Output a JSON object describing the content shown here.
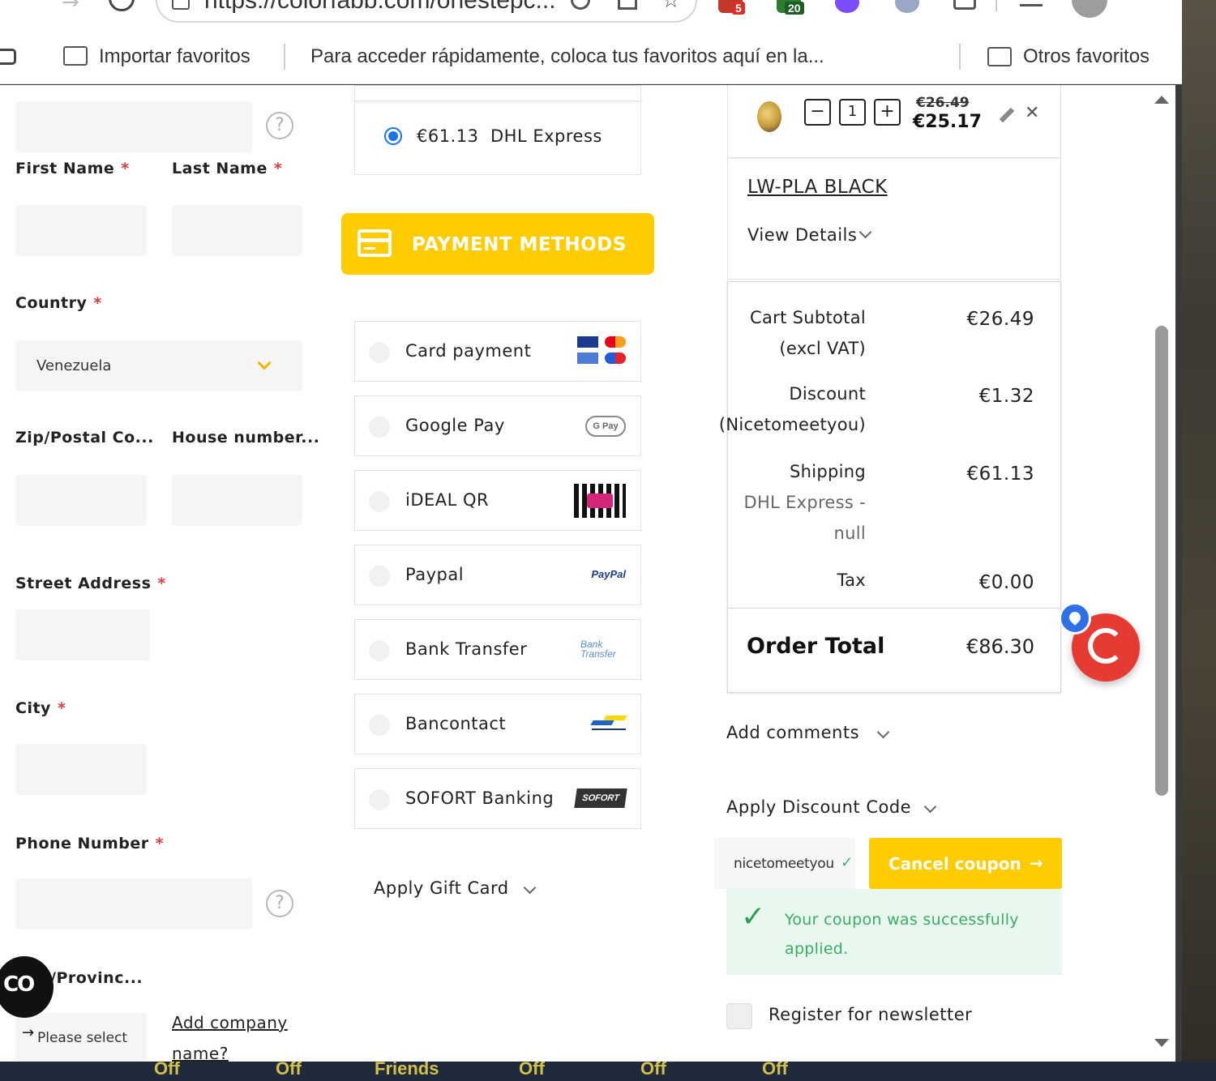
{
  "browser": {
    "url": "https://colorfabb.com/onestepc...",
    "badges": {
      "ext1": "5",
      "ext2": "20"
    }
  },
  "bookmarks": {
    "import": "Importar favoritos",
    "hint": "Para acceder rápidamente, coloca tus favoritos aquí en la...",
    "other": "Otros favoritos"
  },
  "form": {
    "first_name": "First Name",
    "last_name": "Last Name",
    "country": "Country",
    "country_value": "Venezuela",
    "zip": "Zip/Postal Co...",
    "house": "House number...",
    "street": "Street Address",
    "city": "City",
    "phone": "Phone Number",
    "province": "/Provinc...",
    "province_value": "Please select",
    "add_company_1": "Add company",
    "add_company_2": "name?",
    "required": "*",
    "help": "?"
  },
  "shipping": {
    "price": "€61.13",
    "carrier": "DHL Express"
  },
  "payment": {
    "title": "PAYMENT METHODS",
    "options": [
      {
        "label": "Card payment",
        "logo": "visa-mastercard-icon"
      },
      {
        "label": "Google Pay",
        "logo": "G Pay"
      },
      {
        "label": "iDEAL QR",
        "logo": "ideal-qr-icon"
      },
      {
        "label": "Paypal",
        "logo": "PayPal"
      },
      {
        "label": "Bank Transfer",
        "logo": "Bank Transfer"
      },
      {
        "label": "Bancontact",
        "logo": "bancontact-icon"
      },
      {
        "label": "SOFORT Banking",
        "logo": "SOFORT"
      }
    ],
    "gift_card": "Apply Gift Card"
  },
  "cart": {
    "qty": "1",
    "minus": "−",
    "plus": "+",
    "old_price": "€26.49",
    "new_price": "€25.17",
    "product": "LW-PLA BLACK",
    "view_details": "View Details"
  },
  "totals": {
    "subtotal_label_1": "Cart Subtotal",
    "subtotal_label_2": "(excl VAT)",
    "subtotal": "€26.49",
    "discount_label_1": "Discount",
    "discount_label_2": "(Nicetomeetyou)",
    "discount": "€1.32",
    "shipping_label": "Shipping",
    "shipping_sub_1": "DHL Express -",
    "shipping_sub_2": "null",
    "shipping": "€61.13",
    "tax_label": "Tax",
    "tax": "€0.00",
    "order_total_label": "Order Total",
    "order_total": "€86.30"
  },
  "extras": {
    "comments": "Add comments",
    "discount_code": "Apply Discount Code",
    "coupon_value": "nicetomeetyou",
    "cancel_coupon": "Cancel coupon",
    "arrow": "→",
    "success_msg": "Your coupon was successfully applied.",
    "newsletter": "Register for newsletter"
  },
  "overlay": {
    "cc": "CO",
    "arrow": "→"
  },
  "bottom_strip": [
    "Off",
    "Off",
    "Friends",
    "Off",
    "Off",
    "Off"
  ],
  "colors": {
    "accent": "#ffcc00",
    "success": "#3cab66",
    "chat": "#e63b32",
    "radio": "#1a73e8"
  }
}
